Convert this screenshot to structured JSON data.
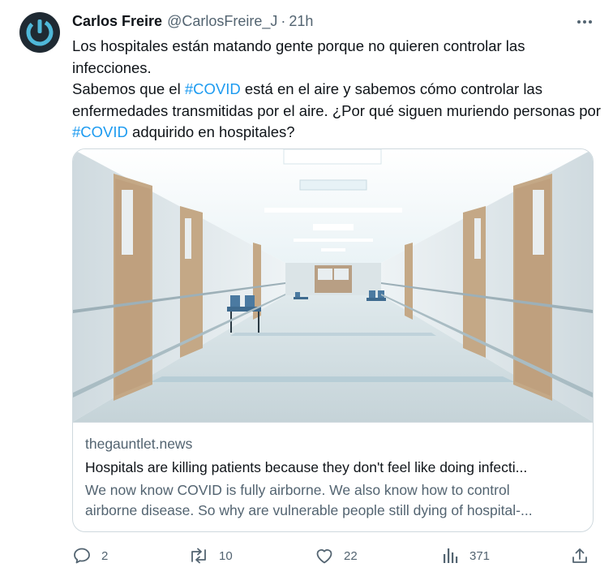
{
  "author": {
    "name": "Carlos Freire",
    "handle": "@CarlosFreire_J",
    "separator": "·",
    "time": "21h",
    "avatar_icon": "power-icon"
  },
  "tweet": {
    "line1": "Los hospitales están matando gente porque no quieren controlar las infecciones.",
    "line2_pre": "Sabemos que el ",
    "hashtag1": "#COVID",
    "line2_post": " está en el aire y sabemos cómo controlar las enfermedades transmitidas por el aire. ¿Por qué siguen muriendo personas por ",
    "hashtag2": "#COVID",
    "line2_end": " adquirido en hospitales?"
  },
  "card": {
    "domain": "thegauntlet.news",
    "title": "Hospitals are killing patients because they don't feel like doing infecti...",
    "description_line1": "We now know COVID is fully airborne. We also know how to control",
    "description_line2": "airborne disease. So why are vulnerable people still dying of hospital-..."
  },
  "actions": {
    "replies": "2",
    "retweets": "10",
    "likes": "22",
    "views": "371"
  },
  "colors": {
    "accent": "#1d9bf0",
    "muted": "#536471",
    "border": "#cfd9de",
    "avatar_bg": "#1f2a33",
    "avatar_ring": "#4fb8d9"
  }
}
